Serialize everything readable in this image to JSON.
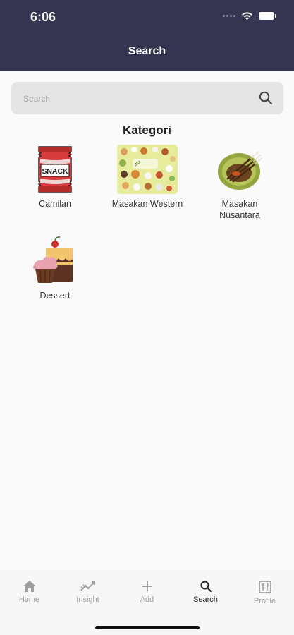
{
  "status_bar": {
    "time": "6:06"
  },
  "header": {
    "title": "Search"
  },
  "search": {
    "placeholder": "Search"
  },
  "section": {
    "title": "Kategori"
  },
  "categories": [
    {
      "label": "Camilan",
      "icon": "snack-bag-icon"
    },
    {
      "label": "Masakan Western",
      "icon": "western-food-collage-icon"
    },
    {
      "label": "Masakan Nusantara",
      "icon": "satay-plate-icon"
    },
    {
      "label": "Dessert",
      "icon": "cake-cupcake-icon"
    }
  ],
  "snack_text": "SNACK",
  "nav": [
    {
      "label": "Home",
      "icon": "home-icon"
    },
    {
      "label": "Insight",
      "icon": "insight-icon"
    },
    {
      "label": "Add",
      "icon": "plus-icon"
    },
    {
      "label": "Search",
      "icon": "search-icon"
    },
    {
      "label": "Profile",
      "icon": "profile-icon"
    }
  ],
  "active_tab": "Search",
  "colors": {
    "header_bg": "#353451",
    "page_bg": "#fafafa",
    "search_bg": "#e5e5e5",
    "active_nav": "#2a2a2a",
    "inactive_nav": "#9e9e9e"
  }
}
